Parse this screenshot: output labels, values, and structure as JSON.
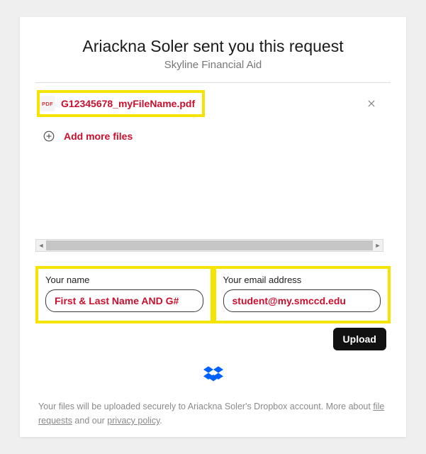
{
  "header": {
    "title": "Ariackna Soler sent you this request",
    "subtitle": "Skyline Financial Aid"
  },
  "files": {
    "item": {
      "badge": "PDF",
      "name": "G12345678_myFileName.pdf"
    },
    "addLabel": "Add more files"
  },
  "form": {
    "name": {
      "label": "Your name",
      "value": "First & Last Name AND G#"
    },
    "email": {
      "label": "Your email address",
      "value": "student@my.smccd.edu"
    }
  },
  "uploadLabel": "Upload",
  "footer": {
    "pre": "Your files will be uploaded securely to Ariackna Soler's Dropbox account. More about ",
    "link1": "file requests",
    "mid": " and our ",
    "link2": "privacy policy",
    "post": "."
  }
}
